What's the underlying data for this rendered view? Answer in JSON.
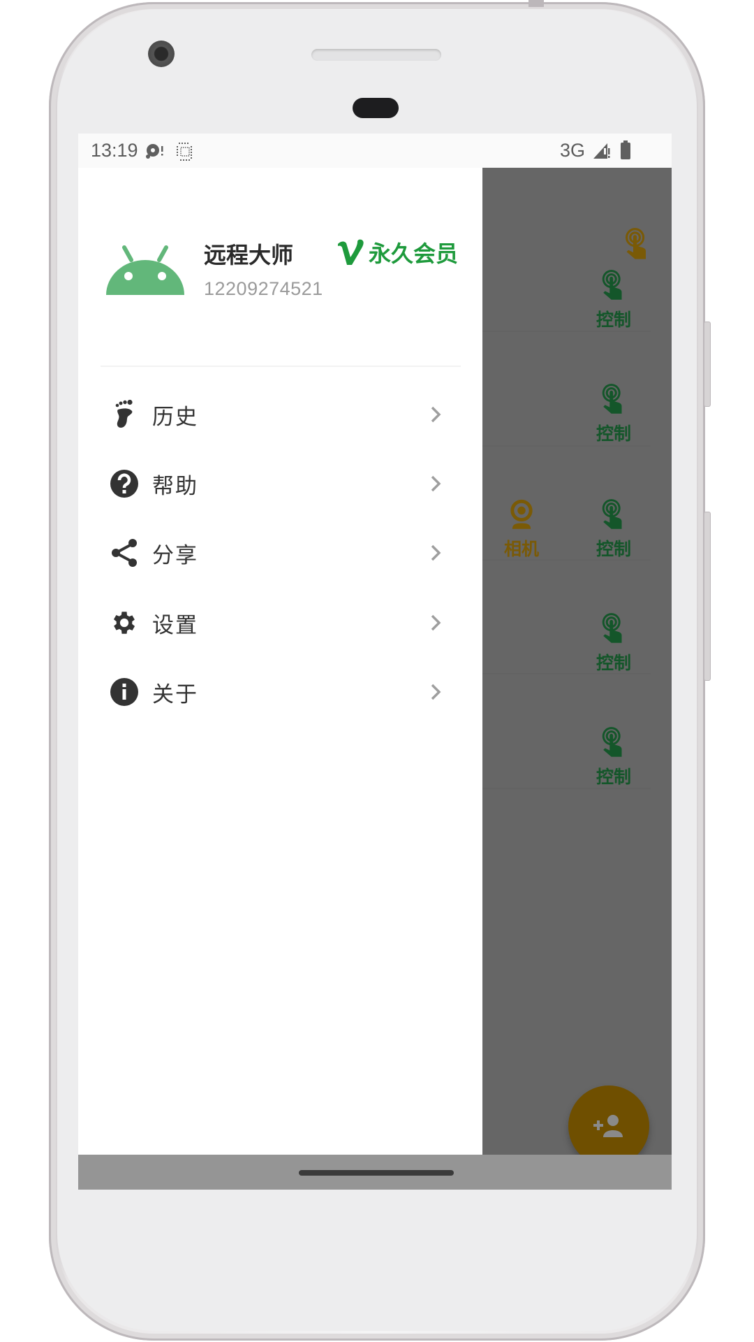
{
  "status_bar": {
    "time": "13:19",
    "left_icons": [
      "media-disc-icon",
      "screenshot-icon"
    ],
    "network": "3G",
    "right_icons": [
      "signal-icon",
      "battery-icon"
    ]
  },
  "drawer": {
    "user": {
      "name": "远程大师",
      "id": "12209274521",
      "avatar_icon": "android-icon",
      "badge_label": "永久会员",
      "badge_icon": "vip-v-icon",
      "badge_color": "#1e9a3c"
    },
    "menu": [
      {
        "label": "历史",
        "icon": "footprint-icon"
      },
      {
        "label": "帮助",
        "icon": "help-circle-icon"
      },
      {
        "label": "分享",
        "icon": "share-icon"
      },
      {
        "label": "设置",
        "icon": "gear-icon"
      },
      {
        "label": "关于",
        "icon": "info-icon"
      }
    ]
  },
  "background_list": {
    "top_action_icon": "touch-icon",
    "rows": [
      {
        "control_label": "控制"
      },
      {
        "control_label": "控制"
      },
      {
        "camera_label": "相机",
        "control_label": "控制"
      },
      {
        "control_label": "控制"
      },
      {
        "control_label": "控制"
      }
    ],
    "control_color": "#14562a",
    "camera_color": "#7a5a06"
  },
  "fab": {
    "icon": "add-person-icon",
    "color": "#6f4f00"
  }
}
